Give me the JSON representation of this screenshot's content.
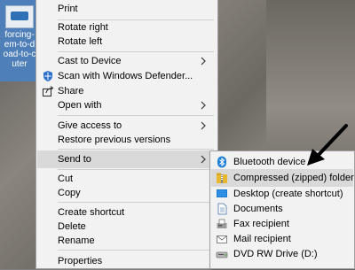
{
  "desktop_icon": {
    "name": "forcing-\nem-to-d\noad-to-c\nuter"
  },
  "menu": {
    "items": [
      {
        "label": "Print"
      },
      {
        "label": "Rotate right"
      },
      {
        "label": "Rotate left"
      },
      {
        "label": "Cast to Device"
      },
      {
        "label": "Scan with Windows Defender..."
      },
      {
        "label": "Share"
      },
      {
        "label": "Open with"
      },
      {
        "label": "Give access to"
      },
      {
        "label": "Restore previous versions"
      },
      {
        "label": "Send to"
      },
      {
        "label": "Cut"
      },
      {
        "label": "Copy"
      },
      {
        "label": "Create shortcut"
      },
      {
        "label": "Delete"
      },
      {
        "label": "Rename"
      },
      {
        "label": "Properties"
      }
    ]
  },
  "send_to": {
    "items": [
      {
        "label": "Bluetooth device"
      },
      {
        "label": "Compressed (zipped) folder"
      },
      {
        "label": "Desktop (create shortcut)"
      },
      {
        "label": "Documents"
      },
      {
        "label": "Fax recipient"
      },
      {
        "label": "Mail recipient"
      },
      {
        "label": "DVD RW Drive (D:)"
      }
    ]
  },
  "colors": {
    "menu_bg": "#f2f2f2",
    "hover_bg": "#d9d9d9",
    "bluetooth": "#1e7fd6",
    "zip_folder": "#e8b730",
    "desktop_blue": "#1b78d0",
    "defender_blue": "#2a6fc9"
  },
  "icons": {
    "scan": "windows-defender-icon",
    "share": "share-icon",
    "bluetooth": "bluetooth-icon",
    "zip": "zip-folder-icon",
    "desktop": "desktop-icon",
    "documents": "documents-icon",
    "fax": "fax-icon",
    "mail": "mail-icon",
    "dvd": "dvd-drive-icon"
  }
}
